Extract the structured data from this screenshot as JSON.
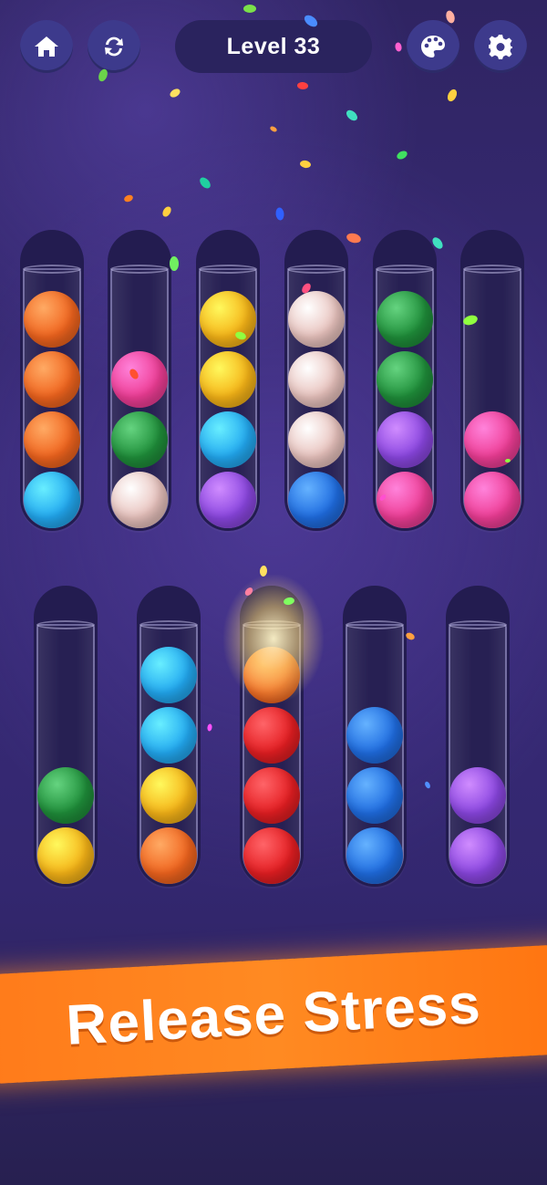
{
  "header": {
    "level_label": "Level 33",
    "buttons": [
      {
        "id": "home",
        "icon": "home-icon"
      },
      {
        "id": "restart",
        "icon": "restart-icon"
      },
      {
        "id": "theme",
        "icon": "palette-icon"
      },
      {
        "id": "settings",
        "icon": "gear-icon"
      }
    ]
  },
  "colors": {
    "orange": "#f0641e",
    "cyan": "#22a8f0",
    "pink": "#ee3d95",
    "green": "#1f8e3a",
    "peach": "#e8c2bd",
    "yellow": "#f5b317",
    "purple": "#8a46e0",
    "blue": "#1f6ce0",
    "red": "#e41e22"
  },
  "tubes_row1": [
    [
      "orange",
      "orange",
      "orange",
      "cyan"
    ],
    [
      "pink",
      "green",
      "peach"
    ],
    [
      "yellow",
      "yellow",
      "cyan",
      "purple"
    ],
    [
      "peach",
      "peach",
      "peach",
      "blue"
    ],
    [
      "green",
      "green",
      "purple",
      "pink"
    ],
    [
      "pink",
      "pink"
    ]
  ],
  "tubes_row2": [
    [
      "green",
      "yellow"
    ],
    [
      "cyan",
      "cyan",
      "yellow",
      "orange"
    ],
    [
      "orange",
      "red",
      "red",
      "red"
    ],
    [
      "blue",
      "blue",
      "blue"
    ],
    [
      "purple",
      "purple"
    ]
  ],
  "banner": {
    "text": "Release Stress"
  }
}
